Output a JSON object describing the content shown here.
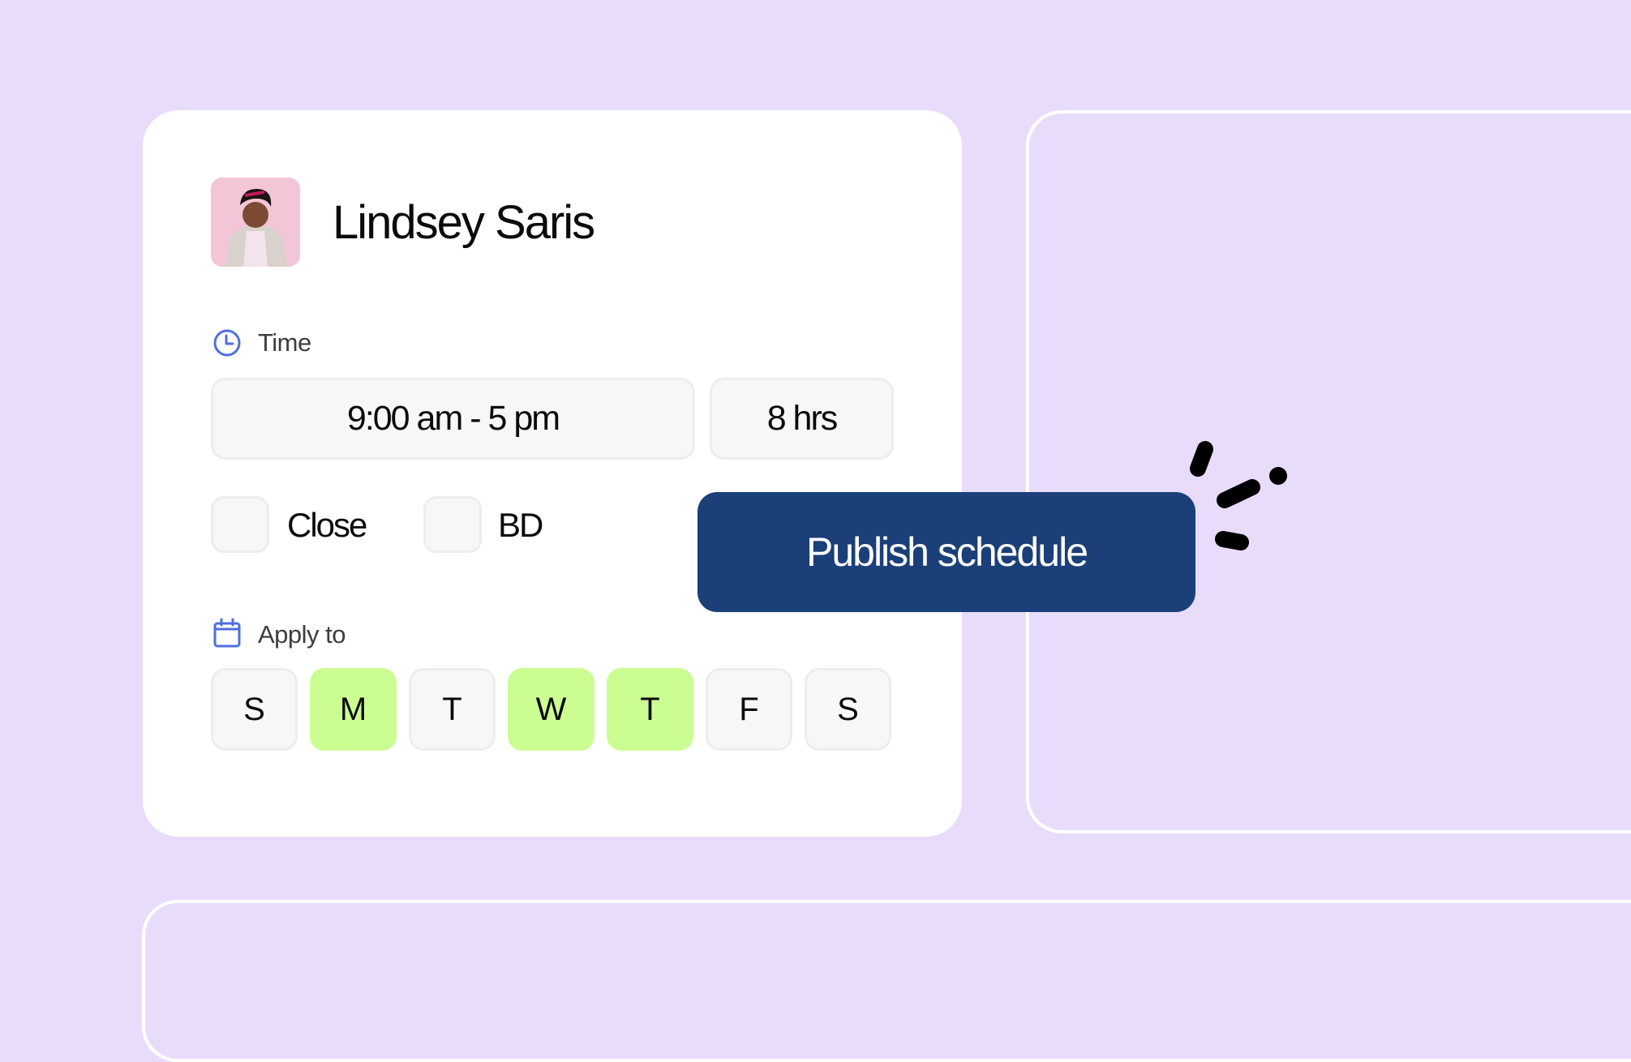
{
  "employee": {
    "name": "Lindsey Saris",
    "avatar_alt": "employee-photo"
  },
  "time_section": {
    "label": "Time",
    "icon": "clock-icon",
    "range_value": "9:00 am - 5 pm",
    "duration_value": "8 hrs"
  },
  "options": [
    {
      "label": "Close",
      "checked": false
    },
    {
      "label": "BD",
      "checked": false
    }
  ],
  "apply_section": {
    "label": "Apply to",
    "icon": "calendar-icon",
    "days": [
      {
        "label": "S",
        "selected": false
      },
      {
        "label": "M",
        "selected": true
      },
      {
        "label": "T",
        "selected": false
      },
      {
        "label": "W",
        "selected": true
      },
      {
        "label": "T",
        "selected": true
      },
      {
        "label": "F",
        "selected": false
      },
      {
        "label": "S",
        "selected": false
      }
    ]
  },
  "publish_button": {
    "label": "Publish schedule"
  },
  "colors": {
    "background": "#e9dcfb",
    "card": "#ffffff",
    "accent_blue": "#1b3f78",
    "icon_blue": "#4f6fe0",
    "day_selected": "#ccfd93",
    "field_bg": "#f8f7f6"
  }
}
